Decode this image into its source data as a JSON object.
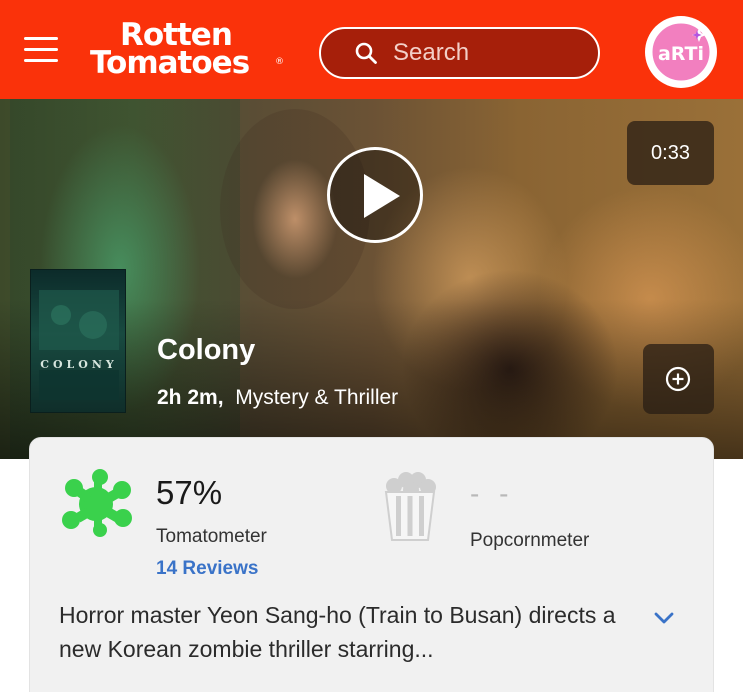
{
  "header": {
    "brand_line1": "Rotten",
    "brand_line2": "Tomatoes",
    "brand_reg": "®",
    "search_placeholder": "Search",
    "avatar_text": "aRTi",
    "accent_color": "#fa320a"
  },
  "hero": {
    "duration": "0:33",
    "poster_title": "COLONY",
    "title": "Colony",
    "runtime": "2h 2m,",
    "genre": "Mystery & Thriller"
  },
  "scores": {
    "tomatometer_value": "57%",
    "tomatometer_label": "Tomatometer",
    "reviews_link": "14 Reviews",
    "popcornmeter_value": "- -",
    "popcornmeter_label": "Popcornmeter",
    "splat_color": "#3ad14c"
  },
  "synopsis": {
    "text": "Horror master Yeon Sang-ho (Train to Busan) directs a new Korean zombie thriller starring..."
  },
  "icons": {
    "menu": "hamburger-menu-icon",
    "search": "search-icon",
    "play": "play-icon",
    "add": "plus-circle-icon",
    "splat": "rotten-splat-icon",
    "popcorn": "popcorn-bucket-icon",
    "expand": "chevron-down-icon"
  }
}
